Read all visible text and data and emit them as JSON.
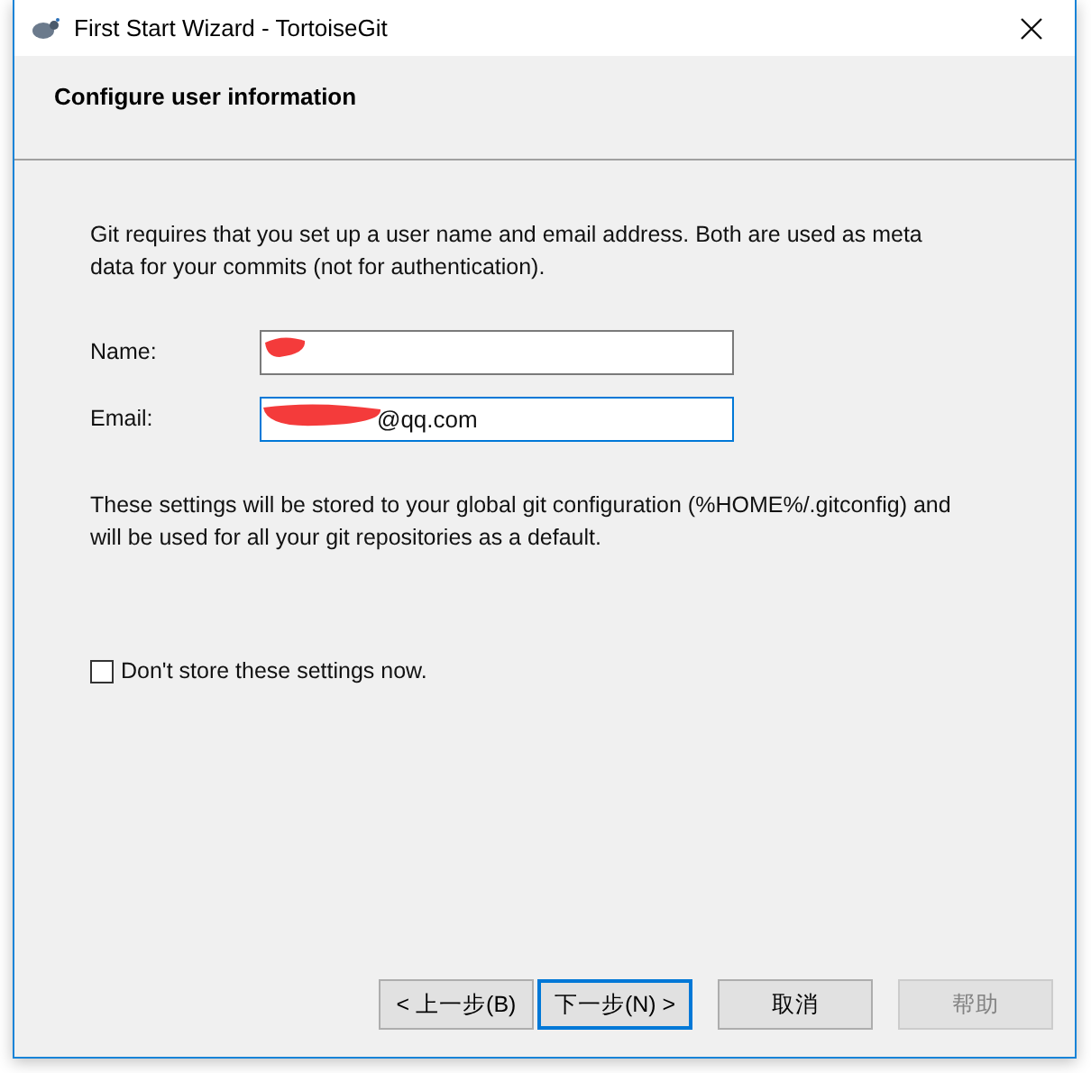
{
  "window": {
    "title": "First Start Wizard - TortoiseGit"
  },
  "header": {
    "title": "Configure user information"
  },
  "intro": "Git requires that you set up a user name and email address. Both are used as meta data for your commits (not for authentication).",
  "fields": [
    {
      "label": "Name:",
      "focused": false,
      "redacted": true
    },
    {
      "label": "Email:",
      "value": "@qq.com",
      "focused": true,
      "redacted": true
    }
  ],
  "note": "These settings will be stored to your global git configuration (%HOME%/.gitconfig) and will be used for all your git repositories as a default.",
  "checkbox": {
    "label": "Don't store these settings now.",
    "checked": false
  },
  "buttons": [
    {
      "label": "< 上一步(B)",
      "default": false,
      "disabled": false
    },
    {
      "label": "下一步(N) >",
      "default": true,
      "disabled": false
    },
    {
      "label": "取消",
      "default": false,
      "disabled": false
    },
    {
      "label": "帮助",
      "default": false,
      "disabled": true
    }
  ]
}
